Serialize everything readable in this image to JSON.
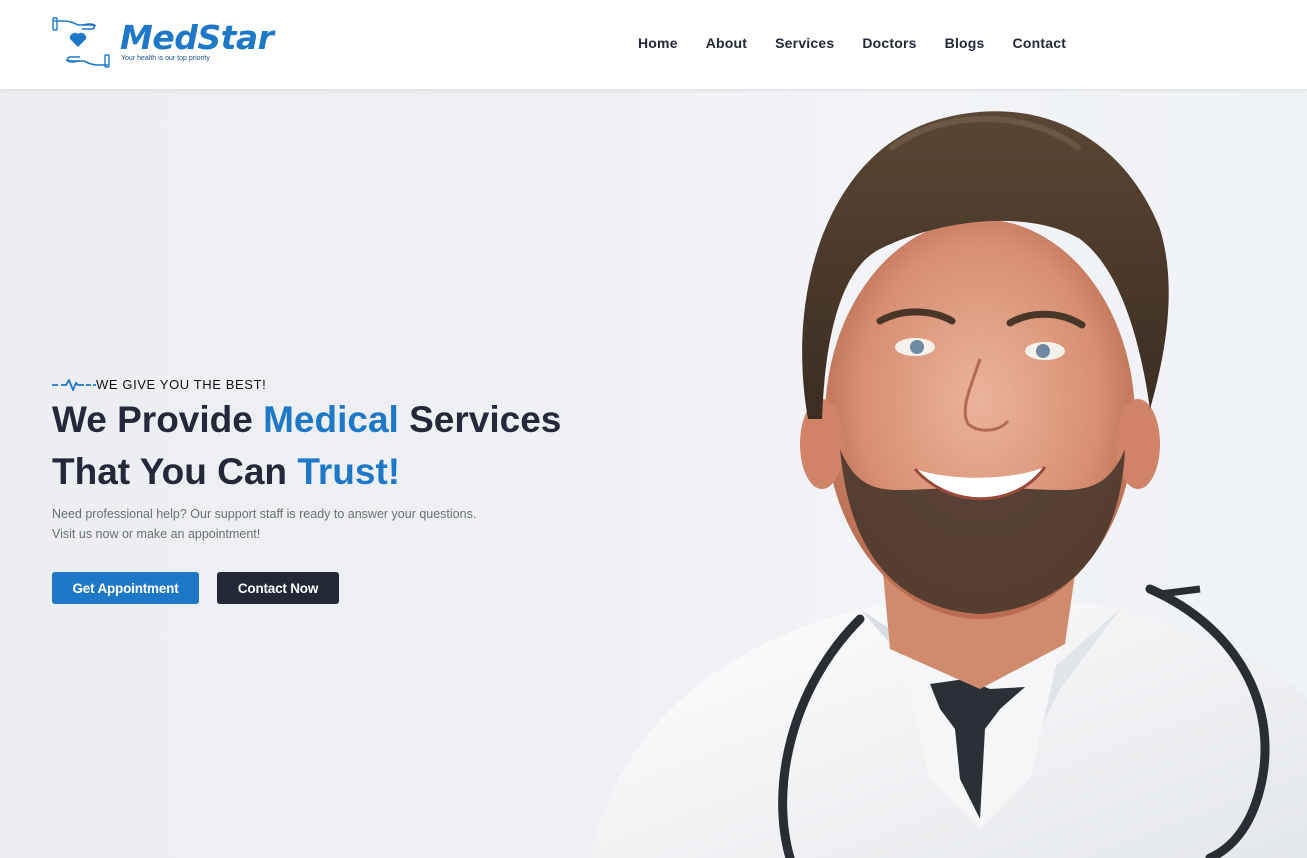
{
  "brand": {
    "name": "MedStar",
    "tagline": "Your health is our top priority",
    "color": "#1e78c8"
  },
  "nav": {
    "items": [
      {
        "label": "Home"
      },
      {
        "label": "About"
      },
      {
        "label": "Services"
      },
      {
        "label": "Doctors"
      },
      {
        "label": "Blogs"
      },
      {
        "label": "Contact"
      }
    ]
  },
  "hero": {
    "eyebrow": "WE GIVE YOU THE BEST!",
    "headline_line1": {
      "pre": "We Provide ",
      "accent": "Medical",
      "post": " Services"
    },
    "headline_line2": {
      "pre": "That You Can ",
      "accent": "Trust!"
    },
    "description_line1": "Need professional help? Our support staff is ready to answer your questions.",
    "description_line2": "Visit us now or make an appointment!",
    "primary_button": "Get Appointment",
    "secondary_button": "Contact Now",
    "accent_color": "#1e78c8",
    "dark_color": "#232839",
    "image": "smiling-doctor-with-stethoscope"
  }
}
